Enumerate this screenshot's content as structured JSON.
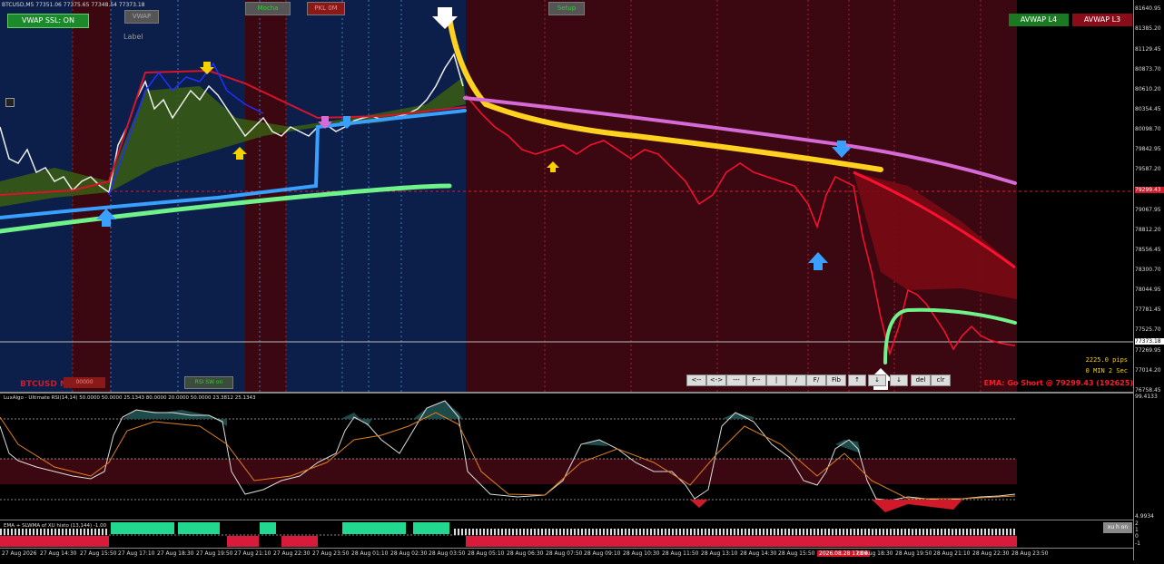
{
  "symbol_header": "BTCUSD,M5  77351.06 77375.65 77348.54 77373.18",
  "watermark": "BTCUSD M5",
  "label_text": "Label",
  "buttons": {
    "vwap_ssl": "VWAP SSL: ON",
    "vwap": "VWAP",
    "top_green": "Mocha",
    "top_red": "PKL 0M",
    "top_mid": "Setup",
    "bottom_red": "00000",
    "bottom_green": "RSI SW on",
    "avwap_l4": "AVWAP L4",
    "avwap_l3": "AVWAP L3",
    "xu_h_on": "xu h on"
  },
  "toolbar": [
    "<--",
    "<->",
    "---",
    "F--",
    "|",
    "/",
    "F/",
    "Fib",
    "↑",
    "↓",
    "↓",
    "del",
    "clr"
  ],
  "info": {
    "pips": "2225.0 pips",
    "timer": "0 MIN 2 Sec",
    "ema_signal": "EMA: Go Short @ 79299.43 (192625)"
  },
  "price_axis": [
    "81640.95",
    "81385.20",
    "81129.45",
    "80873.70",
    "80610.20",
    "80354.45",
    "80098.70",
    "79842.95",
    "79587.20",
    "79299.43",
    "79067.95",
    "78812.20",
    "78556.45",
    "78300.70",
    "78044.95",
    "77781.45",
    "77525.70",
    "77373.18",
    "77269.95",
    "77014.20",
    "76758.45"
  ],
  "current_price": "77373.18",
  "rsi_panel": {
    "title": "LuxAlgo - Ultimate RSI(14,14) 50.0000 50.0000 25.1343 80.0000 20.0000 50.0000 23.3812 25.1343",
    "axis_top": "99.4133",
    "axis_bottom": "4.9934"
  },
  "histo_panel": {
    "title": "EMA + SLWMA of XU histo (13,144) -1.00",
    "axis": [
      "2",
      "1",
      "0",
      "-1"
    ]
  },
  "time_axis": [
    "27 Aug 2026",
    "27 Aug 14:30",
    "27 Aug 15:50",
    "27 Aug 17:10",
    "27 Aug 18:30",
    "27 Aug 19:50",
    "27 Aug 21:10",
    "27 Aug 22:30",
    "27 Aug 23:50",
    "28 Aug 01:10",
    "28 Aug 02:30",
    "28 Aug 03:50",
    "28 Aug 05:10",
    "28 Aug 06:30",
    "28 Aug 07:50",
    "28 Aug 09:10",
    "28 Aug 10:30",
    "28 Aug 11:50",
    "28 Aug 13:10",
    "28 Aug 14:30",
    "28 Aug 15:50",
    "2026.08.28 17:06",
    "28 Aug 18:30",
    "28 Aug 19:50",
    "28 Aug 21:10",
    "28 Aug 22:30",
    "28 Aug 23:50"
  ],
  "colors": {
    "bull_zone": "#0c1f4a",
    "bear_zone": "#3b0812",
    "yellow_line": "#ffd21f",
    "pink_line": "#d66ad6",
    "green_line": "#6ff28a",
    "blue_line": "#3aa0ff",
    "red_line": "#ff1030"
  }
}
